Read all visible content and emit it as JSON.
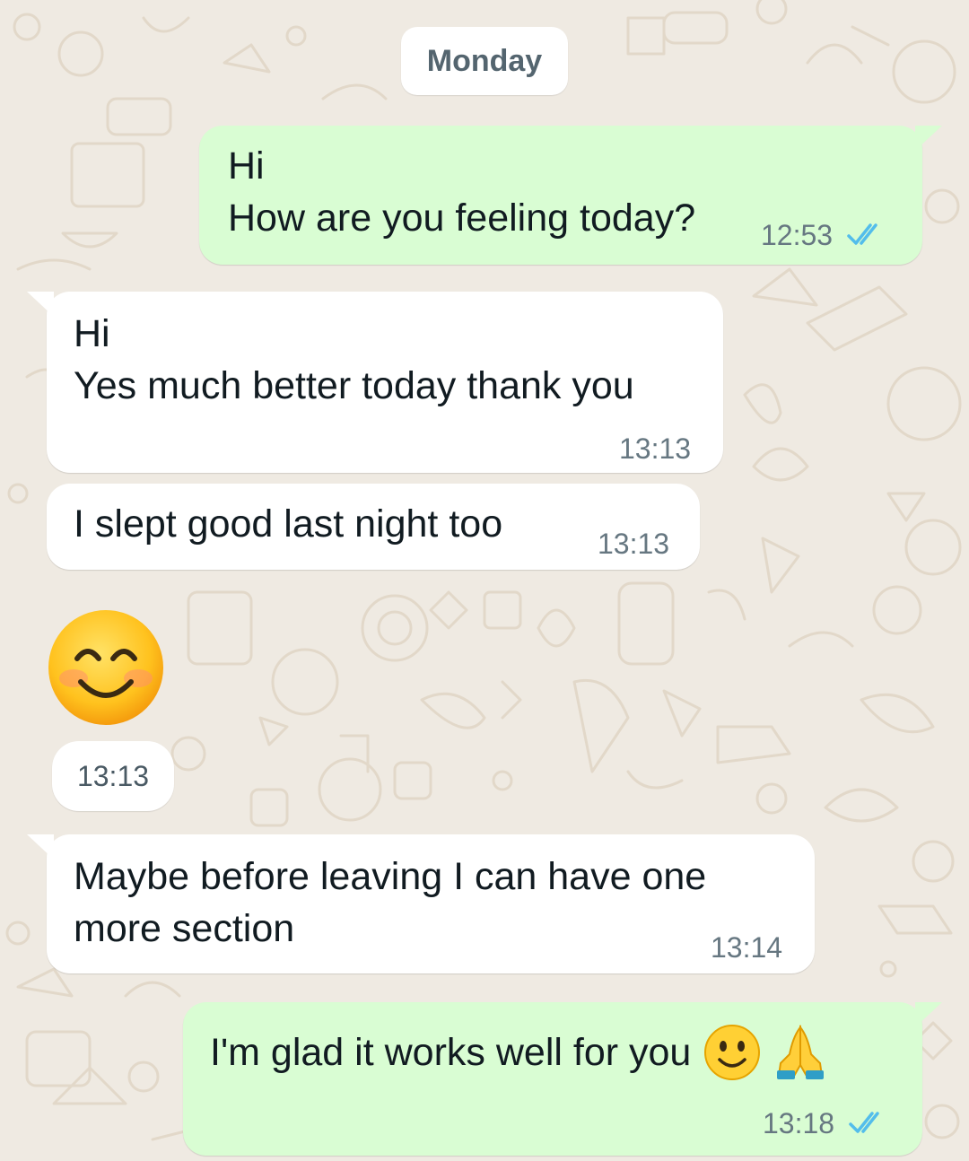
{
  "chat": {
    "date_separator": "Monday",
    "messages": [
      {
        "direction": "outgoing",
        "lines": [
          "Hi",
          "How are you feeling today?"
        ],
        "time": "12:53",
        "status": "read"
      },
      {
        "direction": "incoming",
        "lines": [
          "Hi",
          "Yes much better today thank you"
        ],
        "time": "13:13"
      },
      {
        "direction": "incoming",
        "lines": [
          "I slept good last night too"
        ],
        "time": "13:13"
      },
      {
        "direction": "incoming",
        "emoji": "smiling-face-with-smiling-eyes",
        "time": "13:13"
      },
      {
        "direction": "incoming",
        "lines": [
          "Maybe before leaving I can have one",
          "more section"
        ],
        "time": "13:14"
      },
      {
        "direction": "outgoing",
        "lines": [
          "I'm glad it works well for you"
        ],
        "emojis": [
          "slightly-smiling-face",
          "folded-hands"
        ],
        "time": "13:18",
        "status": "read"
      }
    ]
  },
  "colors": {
    "background": "#efeae2",
    "incoming_bubble": "#ffffff",
    "outgoing_bubble": "#d9fdd3",
    "read_ticks": "#53bdeb",
    "meta_text": "#667781"
  }
}
